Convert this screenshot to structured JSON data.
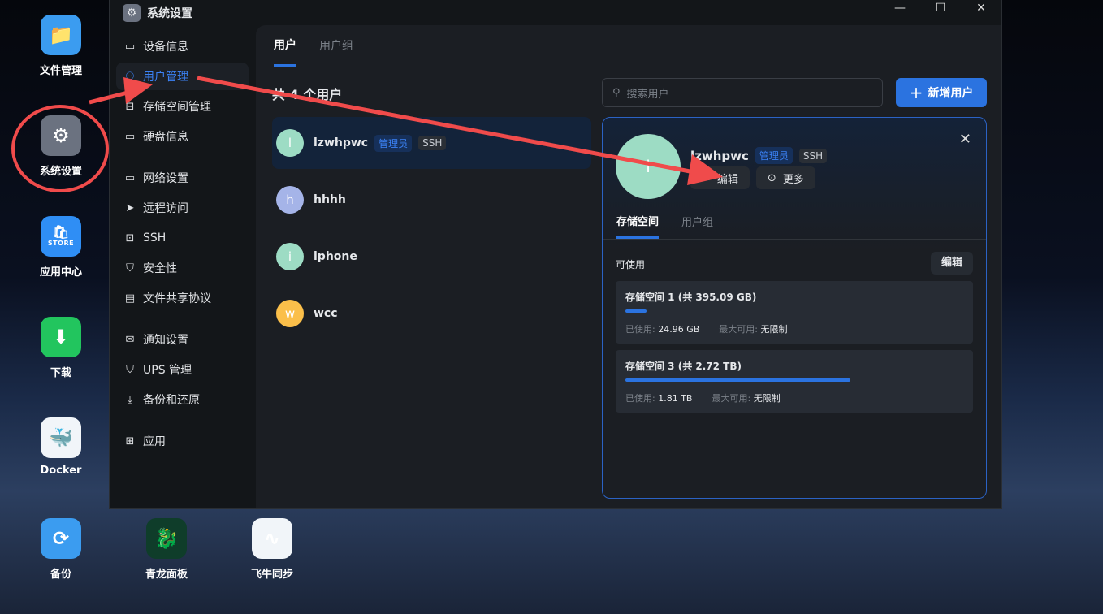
{
  "desktop": {
    "icons": [
      {
        "label": "文件管理",
        "icon": "folder-icon",
        "color": "#3b9cf0"
      },
      {
        "label": "系统设置",
        "icon": "gear-icon",
        "color": "#6b7280"
      },
      {
        "label": "应用中心",
        "icon": "store-icon",
        "color": "#2f8ef5",
        "sub": "STORE"
      },
      {
        "label": "下载",
        "icon": "download-icon",
        "color": "#22c55e"
      },
      {
        "label": "Docker",
        "icon": "docker-icon",
        "color": "#f1f5f9"
      },
      {
        "label": "备份",
        "icon": "backup-icon",
        "color": "#3b9cf0"
      },
      {
        "label": "青龙面板",
        "icon": "qinglong-icon",
        "color": "#0f3d2a"
      },
      {
        "label": "飞牛同步",
        "icon": "sync-icon",
        "color": "#f1f5f9"
      }
    ]
  },
  "window": {
    "title": "系统设置",
    "controls": {
      "minimize": "—",
      "maximize": "☐",
      "close": "✕"
    }
  },
  "sidebar": {
    "items": [
      {
        "label": "设备信息",
        "icon": "device-icon"
      },
      {
        "label": "用户管理",
        "icon": "users-icon",
        "active": true
      },
      {
        "label": "存储空间管理",
        "icon": "storage-icon"
      },
      {
        "label": "硬盘信息",
        "icon": "disk-icon"
      },
      {
        "label": "网络设置",
        "icon": "network-icon"
      },
      {
        "label": "远程访问",
        "icon": "send-icon"
      },
      {
        "label": "SSH",
        "icon": "terminal-icon"
      },
      {
        "label": "安全性",
        "icon": "shield-icon"
      },
      {
        "label": "文件共享协议",
        "icon": "file-icon"
      },
      {
        "label": "通知设置",
        "icon": "mail-icon"
      },
      {
        "label": "UPS 管理",
        "icon": "shield-icon"
      },
      {
        "label": "备份和还原",
        "icon": "backup-icon"
      },
      {
        "label": "应用",
        "icon": "apps-icon"
      }
    ]
  },
  "main": {
    "tabs": [
      "用户",
      "用户组"
    ],
    "count_label": "共 4 个用户",
    "search_placeholder": "搜索用户",
    "add_label": "新增用户",
    "users": [
      {
        "initial": "l",
        "name": "lzwhpwc",
        "badges": [
          "管理员",
          "SSH"
        ],
        "color": "#9ddcc4"
      },
      {
        "initial": "h",
        "name": "hhhh",
        "badges": [],
        "color": "#a5b4e8"
      },
      {
        "initial": "i",
        "name": "iphone",
        "badges": [],
        "color": "#9ddcc4"
      },
      {
        "initial": "w",
        "name": "wcc",
        "badges": [],
        "color": "#fbbf4a"
      }
    ]
  },
  "detail": {
    "initial": "l",
    "name": "lzwhpwc",
    "admin": "管理员",
    "ssh": "SSH",
    "edit": "编辑",
    "more": "更多",
    "tabs": [
      "存储空间",
      "用户组"
    ],
    "available": "可使用",
    "edit_storage": "编辑",
    "volumes": [
      {
        "title": "存储空间 1 (共 395.09 GB)",
        "used_label": "已使用:",
        "used": "24.96 GB",
        "max_label": "最大可用:",
        "max": "无限制",
        "usage_fraction": 0.063
      },
      {
        "title": "存储空间 3 (共 2.72 TB)",
        "used_label": "已使用:",
        "used": "1.81 TB",
        "max_label": "最大可用:",
        "max": "无限制",
        "usage_fraction": 0.665
      }
    ]
  },
  "annotation_color": "#f04b4b"
}
